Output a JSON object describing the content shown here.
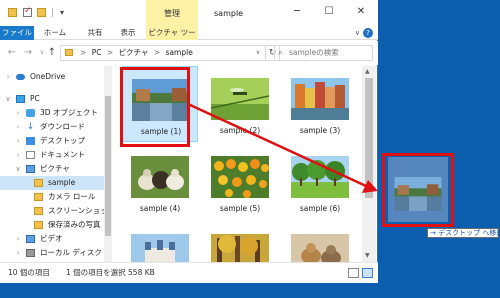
{
  "window": {
    "title": "sample",
    "context_tab_group": "管理",
    "quick_access_dropdown": "▾",
    "minimize": "─",
    "maximize": "☐",
    "close": "✕"
  },
  "ribbon": {
    "tabs": [
      "ファイル",
      "ホーム",
      "共有",
      "表示",
      "ピクチャ ツール"
    ],
    "collapse": "∨",
    "help": "?"
  },
  "navbar": {
    "back": "←",
    "forward": "→",
    "history": "∨",
    "up": "↑",
    "path": [
      "PC",
      "ピクチャ",
      "sample"
    ],
    "path_separator": ">",
    "dropdown": "∨",
    "refresh": "↻",
    "search_placeholder": "sampleの検索",
    "search_icon": "⌕"
  },
  "sidebar": {
    "items": [
      {
        "label": "OneDrive",
        "icon": "cloud-icon",
        "chevron": "›"
      },
      {
        "label": "PC",
        "icon": "pc-icon",
        "chevron": "∨"
      },
      {
        "label": "3D オブジェクト",
        "icon": "3d-objects-icon",
        "chevron": "›"
      },
      {
        "label": "ダウンロード",
        "icon": "download-icon",
        "chevron": "›"
      },
      {
        "label": "デスクトップ",
        "icon": "desktop-icon",
        "chevron": "›"
      },
      {
        "label": "ドキュメント",
        "icon": "documents-icon",
        "chevron": "›"
      },
      {
        "label": "ピクチャ",
        "icon": "pictures-icon",
        "chevron": "∨"
      },
      {
        "label": "sample",
        "icon": "folder-icon",
        "chevron": ""
      },
      {
        "label": "カメラ ロール",
        "icon": "folder-icon",
        "chevron": ""
      },
      {
        "label": "スクリーンショット",
        "icon": "folder-icon",
        "chevron": ""
      },
      {
        "label": "保存済みの写真",
        "icon": "folder-icon",
        "chevron": ""
      },
      {
        "label": "ビデオ",
        "icon": "video-icon",
        "chevron": "›"
      },
      {
        "label": "ローカル ディスク",
        "icon": "disk-icon",
        "chevron": "›"
      }
    ]
  },
  "files": [
    {
      "name": "sample (1)",
      "scene": "canal"
    },
    {
      "name": "sample (2)",
      "scene": "dragonfly"
    },
    {
      "name": "sample (3)",
      "scene": "colorful-houses"
    },
    {
      "name": "sample (4)",
      "scene": "ducks"
    },
    {
      "name": "sample (5)",
      "scene": "tulips"
    },
    {
      "name": "sample (6)",
      "scene": "park"
    },
    {
      "name": "",
      "scene": "castle"
    },
    {
      "name": "",
      "scene": "forest"
    },
    {
      "name": "",
      "scene": "cats"
    }
  ],
  "status": {
    "item_count": "10 個の項目",
    "selection": "1 個の項目を選択  558 KB"
  },
  "drag": {
    "tooltip": "→ デスクトップ へ移動"
  },
  "colors": {
    "accent": "#1979ca",
    "desktop": "#0b5fae",
    "highlight_red": "#e01010",
    "selection": "#cce8ff"
  }
}
